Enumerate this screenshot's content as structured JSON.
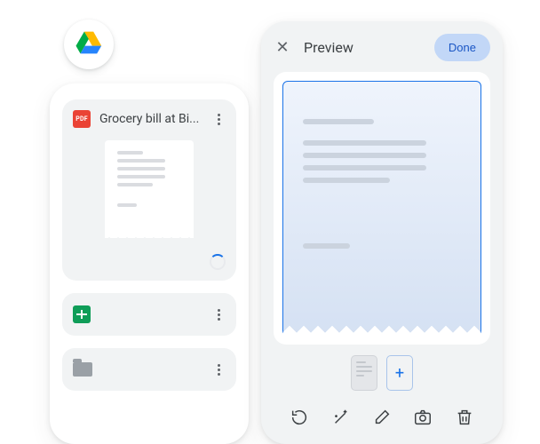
{
  "drive": {
    "file_card": {
      "badge_text": "PDF",
      "title": "Grocery bill at Bi..."
    }
  },
  "preview": {
    "title": "Preview",
    "done_label": "Done",
    "add_page_glyph": "+"
  }
}
